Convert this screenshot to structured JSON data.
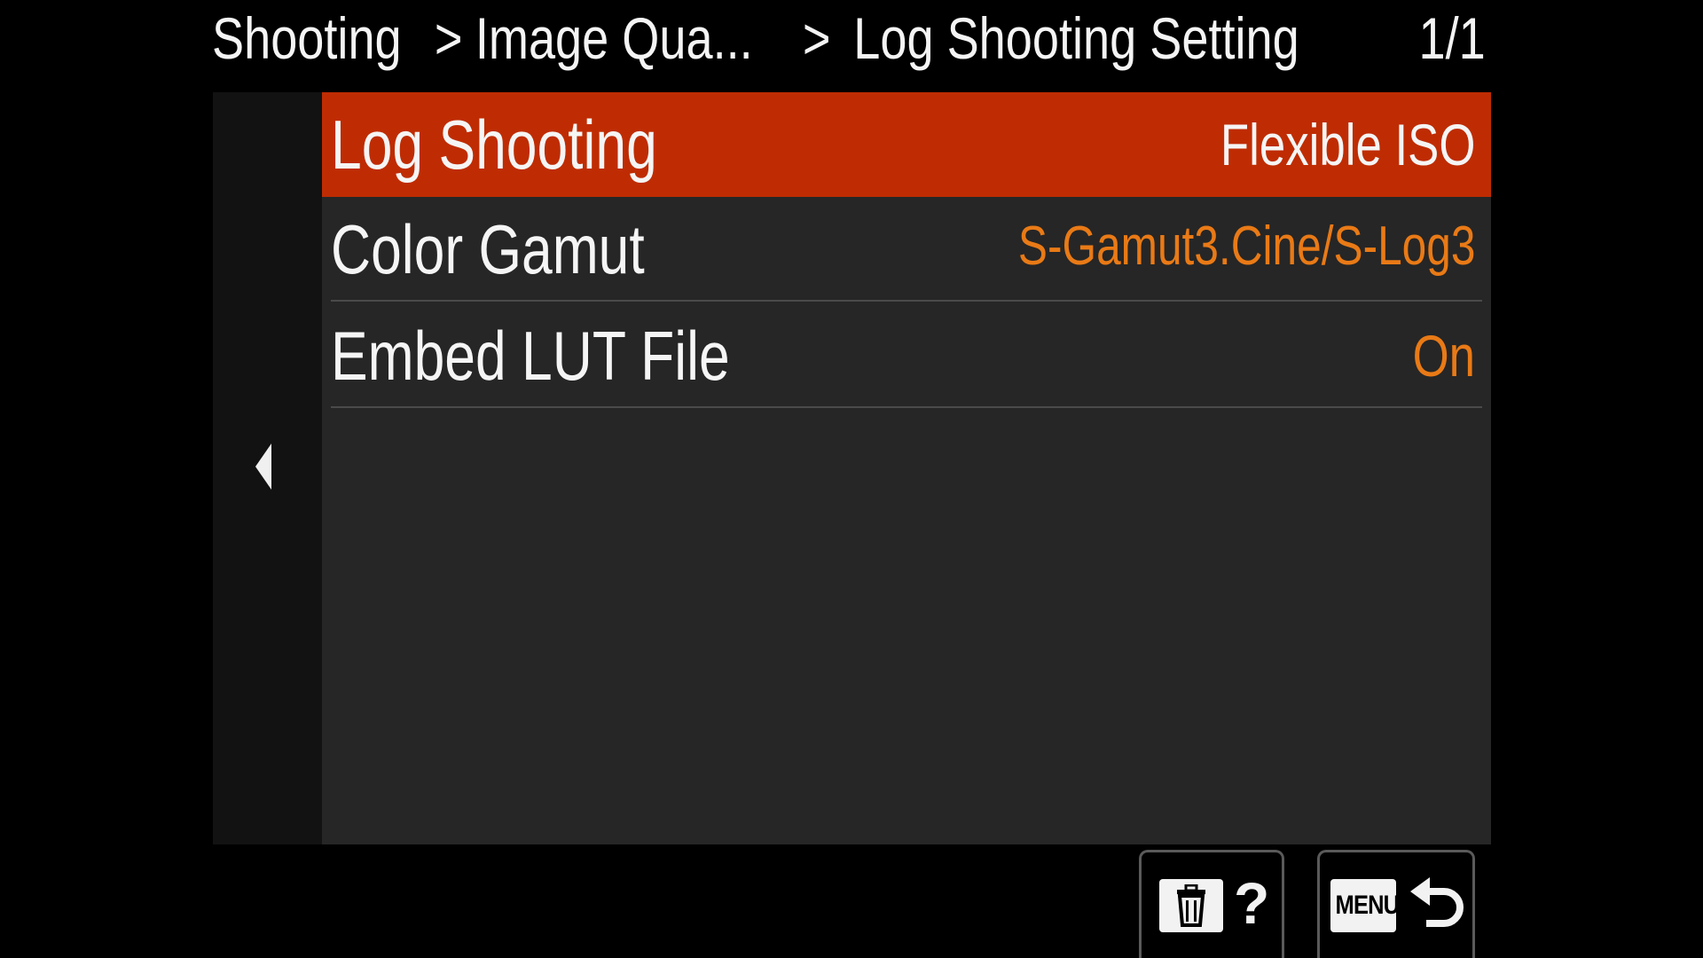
{
  "header": {
    "breadcrumb": [
      "Shooting",
      "Image Qua...",
      "Log Shooting Setting"
    ],
    "separator": ">",
    "page_indicator": "1/1"
  },
  "menu": {
    "items": [
      {
        "label": "Log Shooting",
        "value": "Flexible ISO",
        "selected": true
      },
      {
        "label": "Color Gamut",
        "value": "S-Gamut3.Cine/S-Log3",
        "selected": false
      },
      {
        "label": "Embed LUT File",
        "value": "On",
        "selected": false
      }
    ]
  },
  "footer": {
    "help_mark": "?",
    "menu_label": "MENU"
  },
  "icons": {
    "back": "chevron-left-icon",
    "delete": "trash-icon",
    "help": "help-icon",
    "return": "return-arrow-icon"
  },
  "colors": {
    "selected_row": "#bf2c03",
    "value_accent": "#e97a16",
    "panel": "#262626",
    "side_panel": "#121212"
  }
}
